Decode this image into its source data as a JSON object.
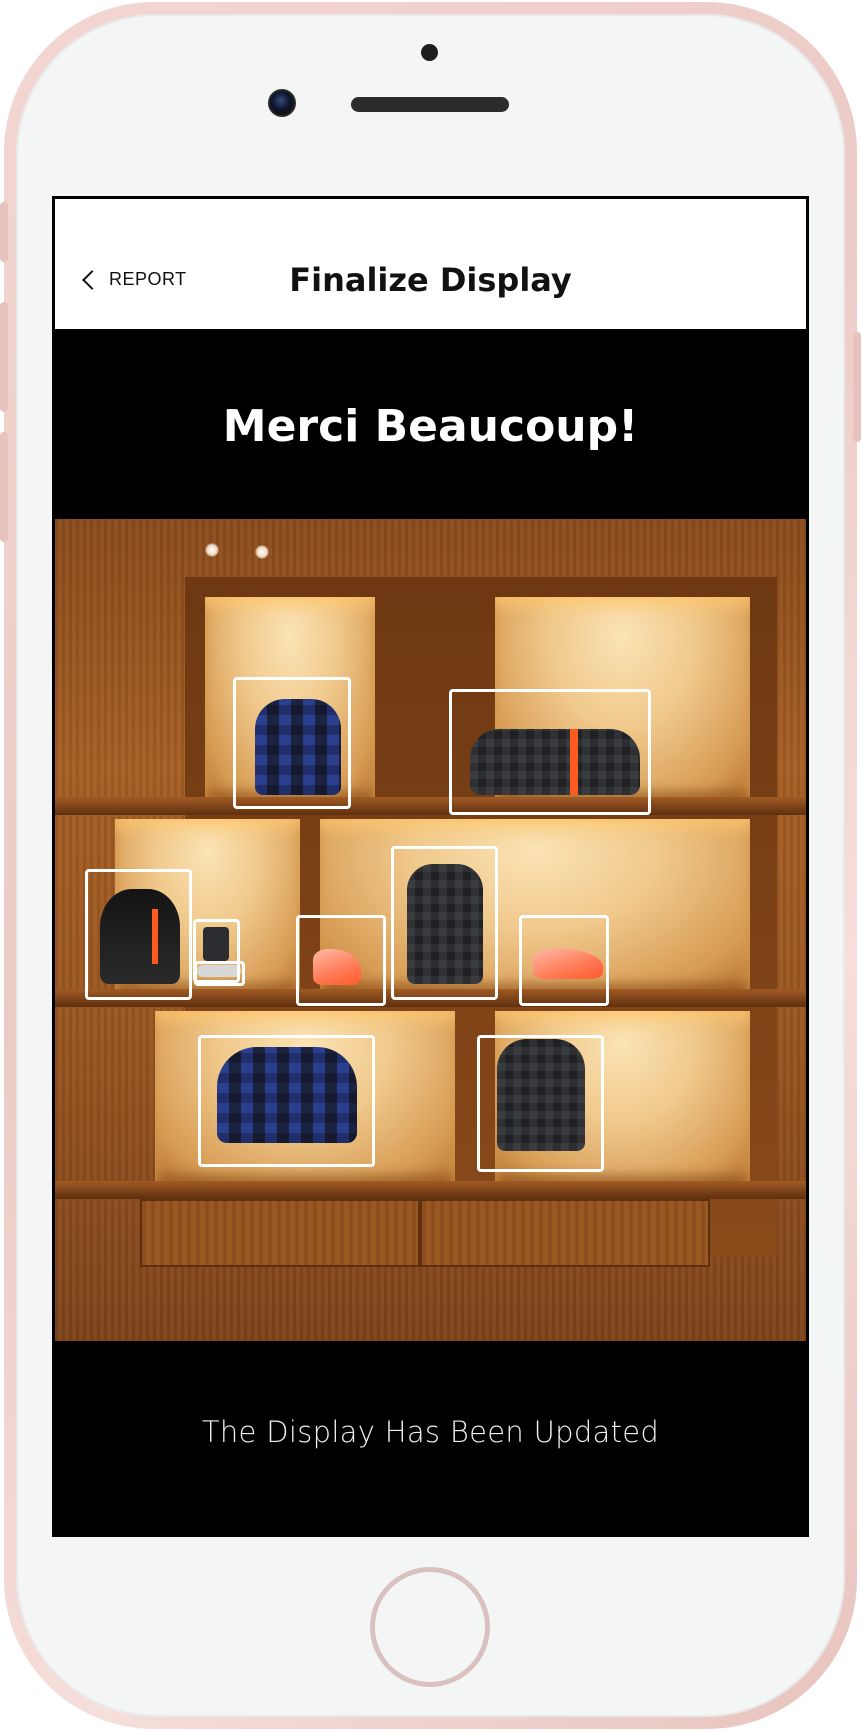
{
  "nav": {
    "back_label": "REPORT",
    "back_icon": "chevron-left-icon",
    "title": "Finalize Display"
  },
  "banner": {
    "title": "Merci Beaucoup!"
  },
  "display_photo": {
    "selected_products": [
      {
        "name": "blue camo backpack"
      },
      {
        "name": "checkered keepall duffle bag"
      },
      {
        "name": "scarf on mannequin bust"
      },
      {
        "name": "phone case"
      },
      {
        "name": "sunglasses"
      },
      {
        "name": "orange sneaker left"
      },
      {
        "name": "checkered backpack center"
      },
      {
        "name": "orange sneaker right"
      },
      {
        "name": "blue camo keepall bag"
      },
      {
        "name": "dark checkered backpack"
      }
    ]
  },
  "footer": {
    "status_text": "The Display Has Been Updated"
  },
  "colors": {
    "screen_background": "#000000",
    "nav_background": "#ffffff",
    "selection_border": "#ffffff",
    "phone_frame": "#eccbc6",
    "accent_orange": "#ff5a1f"
  }
}
